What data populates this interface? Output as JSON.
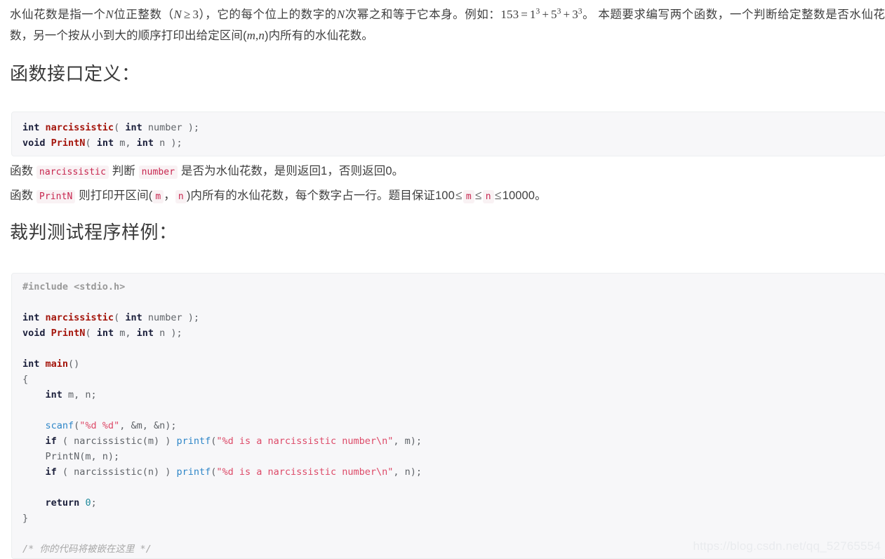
{
  "document": {
    "intro": {
      "seg1": "水仙花数是指一个",
      "var_N1": "N",
      "seg2": "位正整数（",
      "var_N2": "N",
      "ge": "≥",
      "num3": "3",
      "seg3": "），它的每个位上的数字的",
      "var_N3": "N",
      "seg4": "次幂之和等于它本身。例如：",
      "eq_153": "153",
      "eq_equals": "=",
      "eq_b1": "1",
      "eq_e1": "3",
      "eq_plus1": "+",
      "eq_b2": "5",
      "eq_e2": "3",
      "eq_plus2": "+",
      "eq_b3": "3",
      "eq_e3": "3",
      "seg5": "。 本题要求编写两个函数，一个判断给定整数是否水仙花数，另一个按从小到大的顺序打印出给定区间(",
      "var_m": "m",
      "comma": ",",
      "var_n": "n",
      "seg6": ")内所有的水仙花数。"
    },
    "heading_interface": "函数接口定义：",
    "heading_sample": "裁判测试程序样例：",
    "code_interface": [
      [
        {
          "t": "int",
          "c": "kw"
        },
        {
          "t": " ",
          "c": "plain"
        },
        {
          "t": "narcissistic",
          "c": "fn"
        },
        {
          "t": "( ",
          "c": "punct"
        },
        {
          "t": "int",
          "c": "kw"
        },
        {
          "t": " number ",
          "c": "plain"
        },
        {
          "t": ");",
          "c": "punct"
        }
      ],
      [
        {
          "t": "void",
          "c": "kw"
        },
        {
          "t": " ",
          "c": "plain"
        },
        {
          "t": "PrintN",
          "c": "fn"
        },
        {
          "t": "( ",
          "c": "punct"
        },
        {
          "t": "int",
          "c": "kw"
        },
        {
          "t": " m, ",
          "c": "plain"
        },
        {
          "t": "int",
          "c": "kw"
        },
        {
          "t": " n ",
          "c": "plain"
        },
        {
          "t": ");",
          "c": "punct"
        }
      ]
    ],
    "code_sample": [
      [
        {
          "t": "#include <stdio.h>",
          "c": "pre"
        }
      ],
      [],
      [
        {
          "t": "int",
          "c": "kw"
        },
        {
          "t": " ",
          "c": "plain"
        },
        {
          "t": "narcissistic",
          "c": "fn"
        },
        {
          "t": "( ",
          "c": "punct"
        },
        {
          "t": "int",
          "c": "kw"
        },
        {
          "t": " number ",
          "c": "plain"
        },
        {
          "t": ");",
          "c": "punct"
        }
      ],
      [
        {
          "t": "void",
          "c": "kw"
        },
        {
          "t": " ",
          "c": "plain"
        },
        {
          "t": "PrintN",
          "c": "fn"
        },
        {
          "t": "( ",
          "c": "punct"
        },
        {
          "t": "int",
          "c": "kw"
        },
        {
          "t": " m, ",
          "c": "plain"
        },
        {
          "t": "int",
          "c": "kw"
        },
        {
          "t": " n ",
          "c": "plain"
        },
        {
          "t": ");",
          "c": "punct"
        }
      ],
      [],
      [
        {
          "t": "int",
          "c": "kw"
        },
        {
          "t": " ",
          "c": "plain"
        },
        {
          "t": "main",
          "c": "fn"
        },
        {
          "t": "()",
          "c": "punct"
        }
      ],
      [
        {
          "t": "{",
          "c": "punct"
        }
      ],
      [
        {
          "t": "    ",
          "c": "plain"
        },
        {
          "t": "int",
          "c": "kw"
        },
        {
          "t": " m, n;",
          "c": "plain"
        }
      ],
      [],
      [
        {
          "t": "    ",
          "c": "plain"
        },
        {
          "t": "scanf",
          "c": "fn-call"
        },
        {
          "t": "(",
          "c": "punct"
        },
        {
          "t": "\"%d %d\"",
          "c": "str"
        },
        {
          "t": ", &m, &n);",
          "c": "plain"
        }
      ],
      [
        {
          "t": "    ",
          "c": "plain"
        },
        {
          "t": "if",
          "c": "kw"
        },
        {
          "t": " ( narcissistic(m) ) ",
          "c": "plain"
        },
        {
          "t": "printf",
          "c": "fn-call"
        },
        {
          "t": "(",
          "c": "punct"
        },
        {
          "t": "\"%d is a narcissistic number\\n\"",
          "c": "str"
        },
        {
          "t": ", m);",
          "c": "plain"
        }
      ],
      [
        {
          "t": "    PrintN(m, n);",
          "c": "plain"
        }
      ],
      [
        {
          "t": "    ",
          "c": "plain"
        },
        {
          "t": "if",
          "c": "kw"
        },
        {
          "t": " ( narcissistic(n) ) ",
          "c": "plain"
        },
        {
          "t": "printf",
          "c": "fn-call"
        },
        {
          "t": "(",
          "c": "punct"
        },
        {
          "t": "\"%d is a narcissistic number\\n\"",
          "c": "str"
        },
        {
          "t": ", n);",
          "c": "plain"
        }
      ],
      [],
      [
        {
          "t": "    ",
          "c": "plain"
        },
        {
          "t": "return",
          "c": "kw"
        },
        {
          "t": " ",
          "c": "plain"
        },
        {
          "t": "0",
          "c": "num"
        },
        {
          "t": ";",
          "c": "punct"
        }
      ],
      [
        {
          "t": "}",
          "c": "punct"
        }
      ],
      [],
      [
        {
          "t": "/* 你的代码将被嵌在这里 */",
          "c": "comment"
        }
      ]
    ],
    "desc_narcissistic": {
      "seg1": "函数 ",
      "code1": "narcissistic",
      "seg2": " 判断 ",
      "code2": "number",
      "seg3": " 是否为水仙花数，是则返回1，否则返回0。"
    },
    "desc_printn": {
      "seg1": "函数 ",
      "code1": "PrintN",
      "seg2": " 则打印开区间(",
      "code2": "m",
      "seg3": "，",
      "code3": "n",
      "seg4": ")内所有的水仙花数，每个数字占一行。题目保证100",
      "le1": "≤",
      "code4": "m",
      "le2": "≤",
      "code5": "n",
      "le3": "≤",
      "seg5": "10000。"
    },
    "watermark": "https://blog.csdn.net/qq_52765554"
  },
  "colors": {
    "page_background": "#ffffff",
    "body_text": "#3f3f3f",
    "heading_text": "#3a3a3a",
    "code_background": "#f7f7f9",
    "code_border": "#eceef0",
    "keyword": "#1b1f3b",
    "function_def": "#a4150c",
    "function_call": "#2e86c8",
    "string_literal": "#dd4a68",
    "preprocessor": "#999999",
    "number_literal": "#1f8a9b",
    "comment": "#a8a8a8",
    "inline_code_text": "#c7254e",
    "inline_code_background": "#f9f2f4",
    "watermark": "#e9ebee"
  }
}
